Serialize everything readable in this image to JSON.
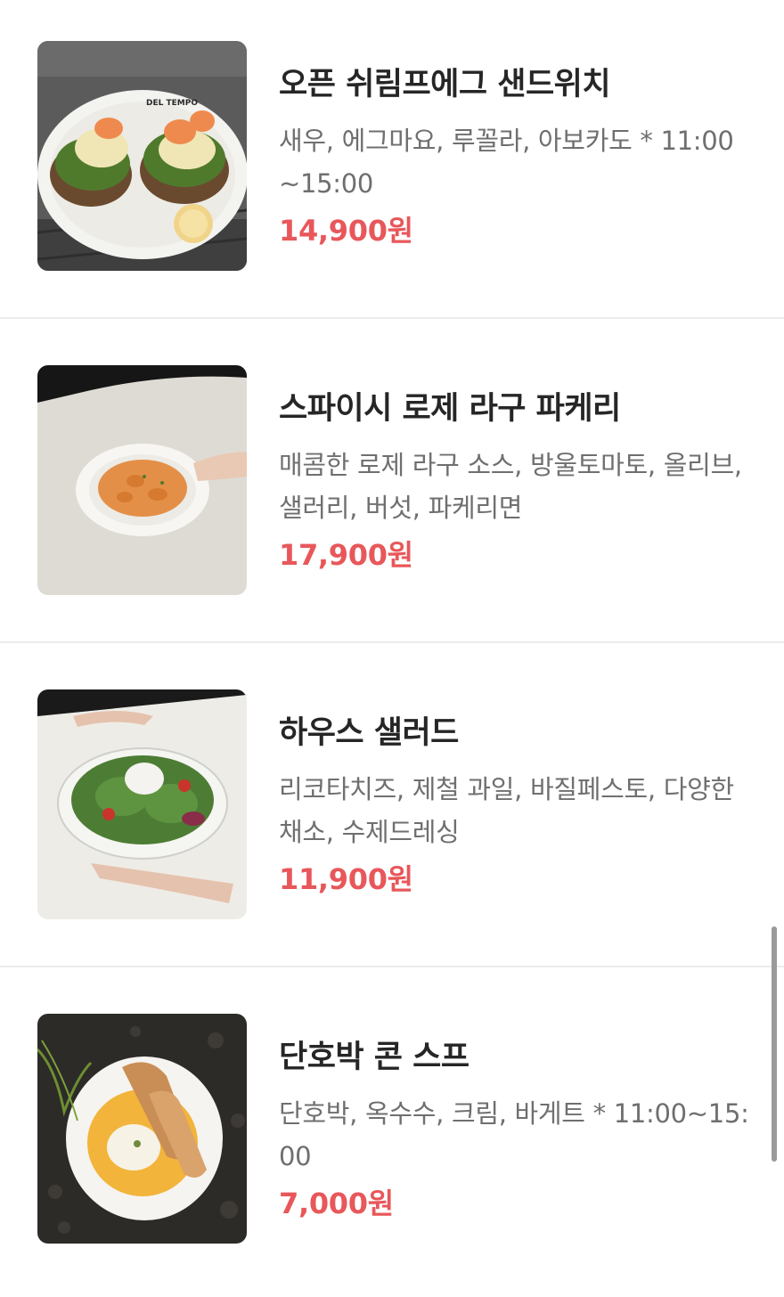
{
  "menu": {
    "items": [
      {
        "name": "오픈 쉬림프에그 샌드위치",
        "description": "새우, 에그마요, 루꼴라, 아보카도 * 11:00~15:00",
        "price": "14,900원",
        "image_label": "DEL TEMPO"
      },
      {
        "name": "스파이시 로제 라구 파케리",
        "description": "매콤한 로제 라구 소스, 방울토마토, 올리브, 샐러리, 버섯, 파케리면",
        "price": "17,900원"
      },
      {
        "name": "하우스 샐러드",
        "description": "리코타치즈, 제철 과일, 바질페스토, 다양한 채소, 수제드레싱",
        "price": "11,900원"
      },
      {
        "name": "단호박 콘 스프",
        "description": "단호박, 옥수수, 크림, 바게트 * 11:00~15:00",
        "price": "7,000원"
      }
    ]
  },
  "colors": {
    "price": "#e8575a",
    "name": "#262626",
    "description": "#6f6f6f",
    "divider": "#ececec"
  }
}
